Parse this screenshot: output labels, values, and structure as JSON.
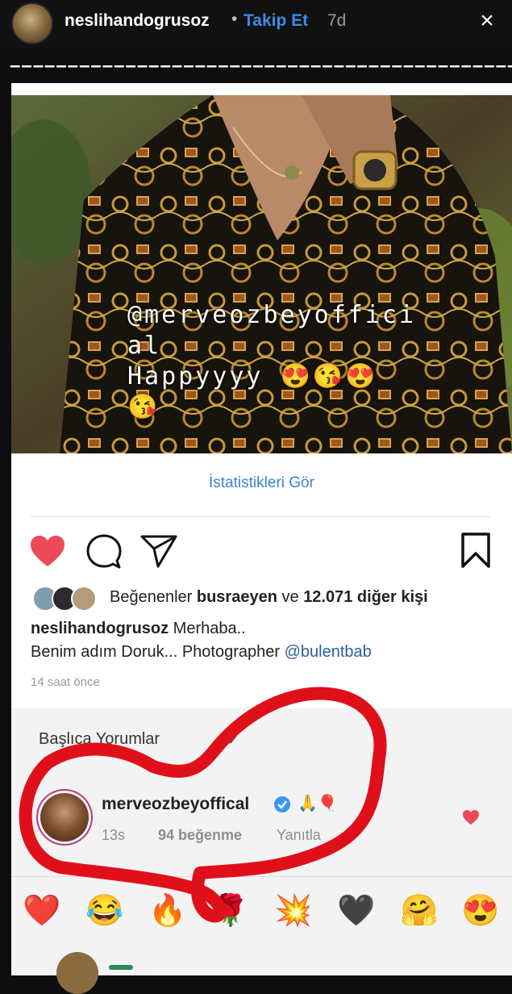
{
  "story_header": {
    "username": "neslihandogrusoz",
    "separator": "•",
    "follow_label": "Takip Et",
    "age": "7d",
    "close_symbol": "×"
  },
  "dashes": "–––––––––––––––––––––––––––––––––––––––––––––––",
  "photo": {
    "overlay_text": "@merveozbeyoffici\nal\nHappyyyy 😍😘😍\n😘"
  },
  "post": {
    "stats_link": "İstatistikleri Gör",
    "likes": {
      "prefix": "Beğenenler ",
      "user": "busraeyen",
      "middle": " ve ",
      "count": "12.071 diğer kişi"
    },
    "caption": {
      "author": "neslihandogrusoz",
      "line1": " Merhaba..",
      "line2_text": "Benim adım Doruk... Photographer ",
      "line2_mention": "@bulentbab"
    },
    "time_ago": "14 saat önce"
  },
  "comments": {
    "sort_label": "Başlıca Yorumlar",
    "comment": {
      "user": "merveozbeyoffical",
      "emoji": "🙏🎈",
      "time": "13s",
      "likes": "94 beğenme",
      "reply": "Yanıtla"
    }
  },
  "reactions": [
    "❤️",
    "😂",
    "🔥",
    "🌹",
    "💥",
    "🖤",
    "🤗",
    "😍"
  ],
  "colors": {
    "accent_blue": "#3a8bea",
    "like_red": "#ed4956",
    "scribble_red": "#e0101a"
  }
}
